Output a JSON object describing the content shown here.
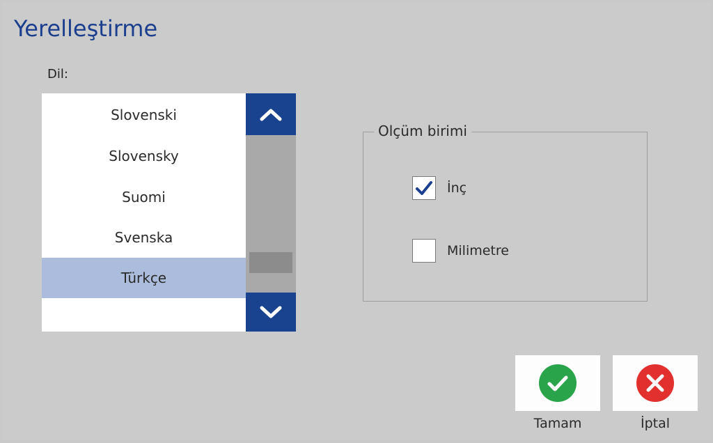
{
  "dialog": {
    "title": "Yerelleştirme"
  },
  "language": {
    "label": "Dil:",
    "items": [
      {
        "label": "Slovenski",
        "selected": false
      },
      {
        "label": "Slovensky",
        "selected": false
      },
      {
        "label": "Suomi",
        "selected": false
      },
      {
        "label": "Svenska",
        "selected": false
      },
      {
        "label": "Türkçe",
        "selected": true
      }
    ],
    "scroll_up_icon": "chevron-up-icon",
    "scroll_down_icon": "chevron-down-icon"
  },
  "units": {
    "legend": "Olçüm birimi",
    "options": [
      {
        "label": "İnç",
        "checked": true
      },
      {
        "label": "Milimetre",
        "checked": false
      }
    ]
  },
  "actions": {
    "ok_label": "Tamam",
    "cancel_label": "İptal",
    "ok_icon": "checkmark-circle-icon",
    "cancel_icon": "x-circle-icon"
  },
  "colors": {
    "title": "#1b3f8e",
    "scroll_button": "#19438f",
    "selection": "#abbcdc",
    "ok": "#2aa44a",
    "cancel": "#e2302e"
  }
}
